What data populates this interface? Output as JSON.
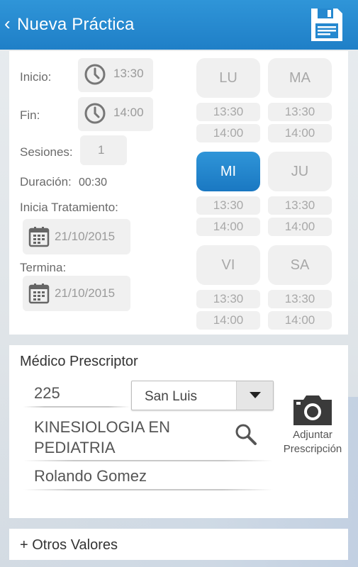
{
  "header": {
    "back_icon": "chevron-left-icon",
    "title": "Nueva Práctica",
    "save_icon": "floppy-disk-icon",
    "bg_color": "#2b8fd4"
  },
  "schedule": {
    "start_label": "Inicio:",
    "start_value": "13:30",
    "end_label": "Fin:",
    "end_value": "14:00",
    "sessions_label": "Sesiones:",
    "sessions_value": "1",
    "duration_label": "Duración:",
    "duration_value": "00:30",
    "start_treatment_label": "Inicia Tratamiento:",
    "start_treatment_date": "21/10/2015",
    "end_treatment_label": "Termina:",
    "end_treatment_date": "21/10/2015"
  },
  "days": [
    {
      "label": "LU",
      "from": "13:30",
      "to": "14:00",
      "selected": false
    },
    {
      "label": "MA",
      "from": "13:30",
      "to": "14:00",
      "selected": false
    },
    {
      "label": "MI",
      "from": "13:30",
      "to": "14:00",
      "selected": true
    },
    {
      "label": "JU",
      "from": "13:30",
      "to": "14:00",
      "selected": false
    },
    {
      "label": "VI",
      "from": "13:30",
      "to": "14:00",
      "selected": false
    },
    {
      "label": "SA",
      "from": "13:30",
      "to": "14:00",
      "selected": false
    }
  ],
  "prescriber": {
    "section_title": "Médico Prescriptor",
    "license_number": "225",
    "province_selected": "San Luis",
    "specialty_line1": "KINESIOLOGIA EN",
    "specialty_line2": "PEDIATRIA",
    "doctor_name": "Rolando Gomez",
    "attach_label_line1": "Adjuntar",
    "attach_label_line2": "Prescripción"
  },
  "other": {
    "label": "+ Otros Valores"
  },
  "colors": {
    "accent": "#1f7fc7",
    "selected_day": "#1f7fc7",
    "pill_bg": "#f0f0f0"
  }
}
